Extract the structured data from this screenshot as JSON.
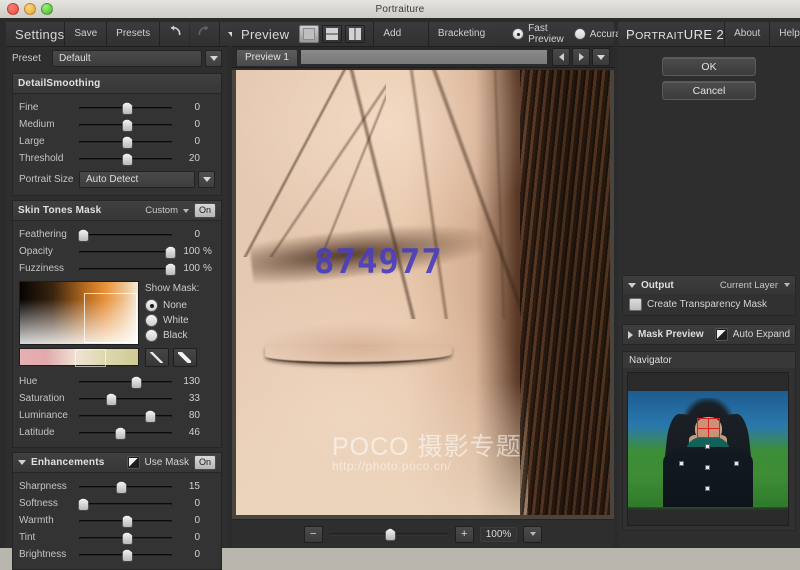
{
  "window": {
    "title": "Portraiture",
    "controls": [
      "close",
      "minimize",
      "zoom"
    ]
  },
  "settings_panel": {
    "title": "Settings",
    "toolbar": {
      "save": "Save",
      "presets": "Presets",
      "undo_icon": "undo-arrow-icon",
      "redo_icon": "redo-arrow-icon",
      "menu_icon": "chevron-down-icon"
    },
    "preset": {
      "label": "Preset",
      "value": "Default"
    },
    "detail_smoothing": {
      "title": "DetailSmoothing",
      "sliders": [
        {
          "label": "Fine",
          "value": "0",
          "pct": 50,
          "unit": ""
        },
        {
          "label": "Medium",
          "value": "0",
          "pct": 50,
          "unit": ""
        },
        {
          "label": "Large",
          "value": "0",
          "pct": 50,
          "unit": ""
        },
        {
          "label": "Threshold",
          "value": "20",
          "pct": 50,
          "unit": ""
        }
      ],
      "portrait_size": {
        "label": "Portrait Size",
        "value": "Auto Detect"
      }
    },
    "skin_tones_mask": {
      "title": "Skin Tones Mask",
      "selector": "Custom",
      "toggle": "On",
      "sliders": [
        {
          "label": "Feathering",
          "value": "0",
          "pct": 3,
          "unit": ""
        },
        {
          "label": "Opacity",
          "value": "100",
          "pct": 97,
          "unit": "%"
        },
        {
          "label": "Fuzziness",
          "value": "100",
          "pct": 97,
          "unit": "%"
        }
      ],
      "show_mask": {
        "label": "Show Mask:",
        "options": [
          "None",
          "White",
          "Black"
        ],
        "selected": "None"
      },
      "pickers": [
        "eyedropper-add-icon",
        "eyedropper-subtract-icon"
      ],
      "color_sliders": [
        {
          "label": "Hue",
          "value": "130",
          "pct": 60,
          "unit": ""
        },
        {
          "label": "Saturation",
          "value": "33",
          "pct": 33,
          "unit": ""
        },
        {
          "label": "Luminance",
          "value": "80",
          "pct": 75,
          "unit": ""
        },
        {
          "label": "Latitude",
          "value": "46",
          "pct": 43,
          "unit": ""
        }
      ]
    },
    "enhancements": {
      "title": "Enhancements",
      "use_mask_label": "Use Mask",
      "use_mask_checked": true,
      "toggle": "On",
      "sliders": [
        {
          "label": "Sharpness",
          "value": "15",
          "pct": 44,
          "unit": ""
        },
        {
          "label": "Softness",
          "value": "0",
          "pct": 3,
          "unit": ""
        },
        {
          "label": "Warmth",
          "value": "0",
          "pct": 50,
          "unit": ""
        },
        {
          "label": "Tint",
          "value": "0",
          "pct": 50,
          "unit": ""
        },
        {
          "label": "Brightness",
          "value": "0",
          "pct": 50,
          "unit": ""
        }
      ]
    }
  },
  "preview_panel": {
    "title": "Preview",
    "view_modes": [
      "single-view-icon",
      "split-horizontal-icon",
      "split-vertical-icon"
    ],
    "view_mode_selected": 0,
    "add_preview": "Add Preview",
    "bracketing": "Bracketing",
    "quality": {
      "options": [
        "Fast Preview",
        "Accurate"
      ],
      "selected": "Fast Preview"
    },
    "tabs": [
      {
        "label": "Preview 1"
      }
    ],
    "tab_nav": [
      "prev-arrow-icon",
      "next-arrow-icon",
      "tab-menu-icon"
    ],
    "image": {
      "watermark_number": "874977",
      "watermark_brand": "POCO 摄影专题",
      "watermark_url": "http://photo.poco.cn/"
    },
    "zoom": {
      "minus": "−",
      "plus": "+",
      "level": "100%",
      "slider_pct": 50
    }
  },
  "right_panel": {
    "brand_prefix": "P",
    "brand_small": "ORTRAIT",
    "brand_bold": "URE",
    "brand_full": "PORTRAITURE 2",
    "version": "2",
    "about": "About",
    "help": "Help",
    "ok": "OK",
    "cancel": "Cancel",
    "output": {
      "title": "Output",
      "selector": "Current Layer",
      "transparency_label": "Create Transparency Mask",
      "transparency_checked": false
    },
    "mask_preview": {
      "title": "Mask Preview",
      "auto_expand_label": "Auto Expand",
      "auto_expand_checked": true
    },
    "navigator": {
      "title": "Navigator"
    }
  }
}
